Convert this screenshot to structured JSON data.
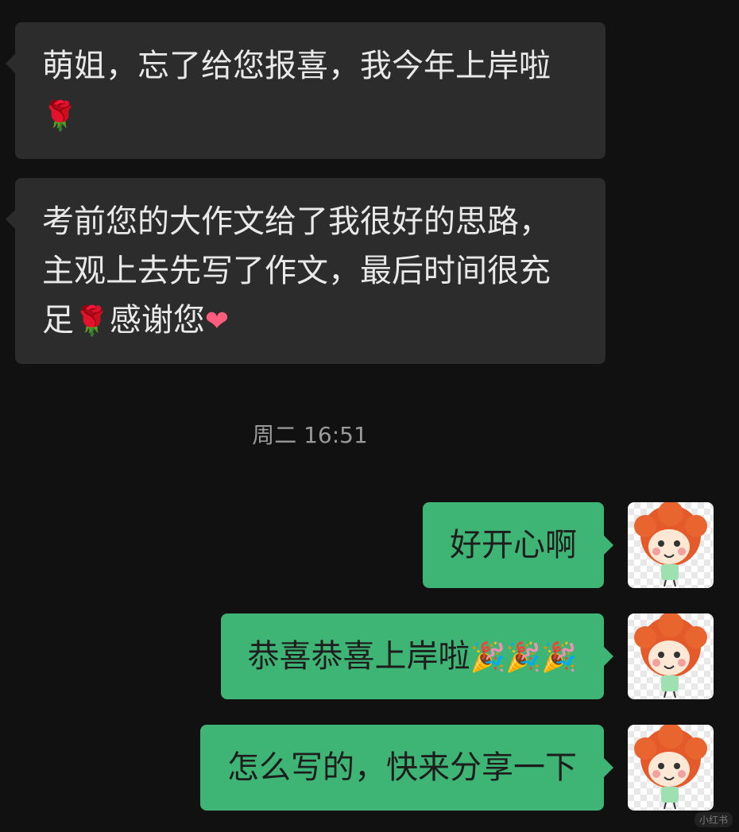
{
  "messages_in": [
    {
      "text": "萌姐，忘了给您报喜，我今年上岸啦",
      "emoji": "🌹"
    },
    {
      "text_a": "考前您的大作文给了我很好的思路，主观上去先写了作文，最后时间很充足",
      "emoji_a": "🌹",
      "text_b": "感谢您",
      "emoji_b": "❤"
    }
  ],
  "timestamp": "周二 16:51",
  "messages_out": [
    {
      "text": "好开心啊",
      "emoji": ""
    },
    {
      "text": "恭喜恭喜上岸啦",
      "emoji": "🎉🎉🎉"
    },
    {
      "text": "怎么写的，快来分享一下",
      "emoji": ""
    }
  ],
  "watermark": "小红书",
  "colors": {
    "background": "#111111",
    "incoming_bubble": "#2c2c2c",
    "outgoing_bubble": "#3eb575"
  }
}
